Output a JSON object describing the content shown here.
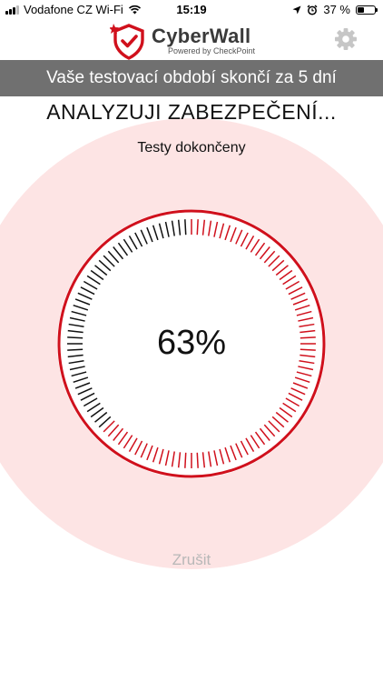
{
  "status_bar": {
    "carrier": "Vodafone CZ Wi-Fi",
    "time": "15:19",
    "battery_text": "37 %",
    "battery_level": 0.37,
    "icons": [
      "signal-icon",
      "wifi-icon",
      "location-icon",
      "alarm-icon",
      "battery-icon"
    ]
  },
  "header": {
    "brand_name": "CyberWall",
    "brand_tagline": "Powered by CheckPoint",
    "settings_icon": "gear-icon"
  },
  "banner": {
    "text": "Vaše testovací období skončí za 5 dní"
  },
  "scan": {
    "title": "ANALYZUJI ZABEZPEČENÍ...",
    "status": "Testy dokončeny",
    "progress_percent": 63,
    "progress_text": "63%",
    "cancel_label": "Zrušit"
  },
  "colors": {
    "accent": "#d0101c",
    "halo": "#fde4e4",
    "pending_tick": "#111111",
    "banner": "#707070",
    "cancel": "#b8b8b8"
  }
}
